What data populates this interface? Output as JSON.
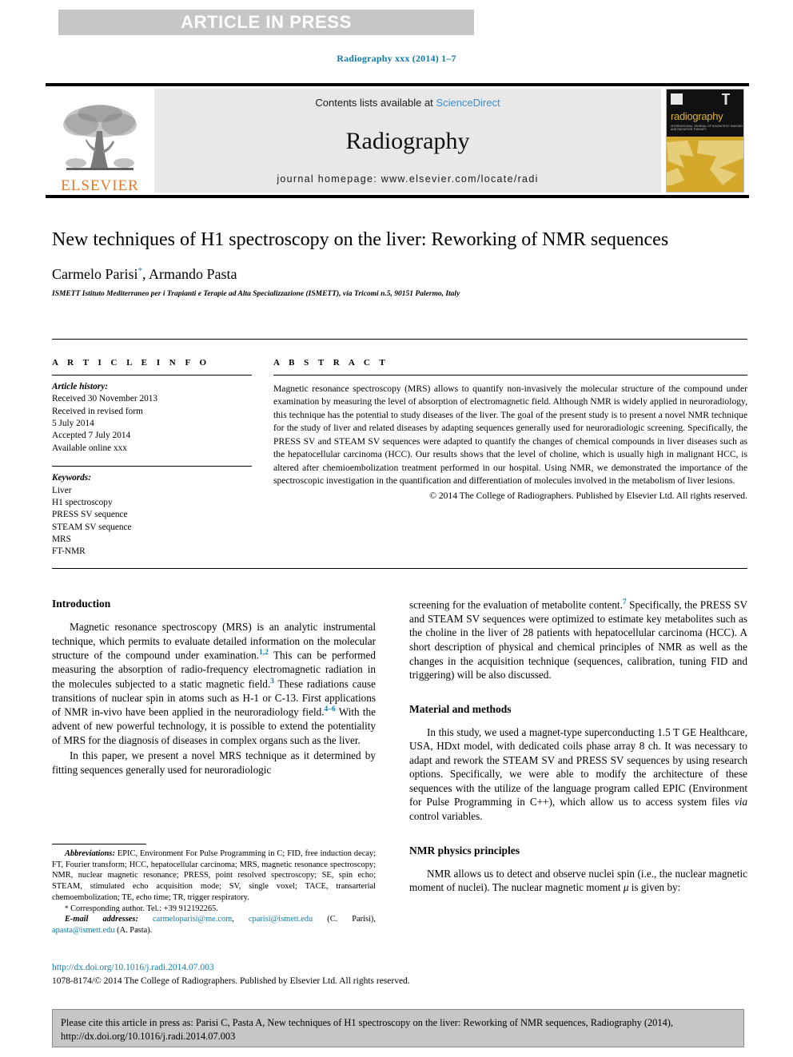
{
  "banner": {
    "text": "ARTICLE IN PRESS"
  },
  "running_head": "Radiography xxx (2014) 1–7",
  "masthead": {
    "publisher_name": "ELSEVIER",
    "contents_prefix": "Contents lists available at ",
    "contents_link": "ScienceDirect",
    "journal_name": "Radiography",
    "homepage": "journal homepage: www.elsevier.com/locate/radi",
    "cover_title": "radiography",
    "cover_subtitle": "INTERNATIONAL JOURNAL OF DIAGNOSTIC IMAGING AND RADIATION THERAPY"
  },
  "article": {
    "title": "New techniques of H1 spectroscopy on the liver: Reworking of NMR sequences",
    "authors": "Carmelo Parisi",
    "author_marker": "*",
    "authors_rest": ", Armando Pasta",
    "affiliation": "ISMETT Istituto Mediterraneo per i Trapianti e Terapie ad Alta Specializzazione (ISMETT), via Tricomi n.5, 90151 Palermo, Italy"
  },
  "info": {
    "label": "A R T I C L E   I N F O",
    "history_label": "Article history:",
    "history": [
      "Received 30 November 2013",
      "Received in revised form",
      "5 July 2014",
      "Accepted 7 July 2014",
      "Available online xxx"
    ],
    "keywords_label": "Keywords:",
    "keywords": [
      "Liver",
      "H1 spectroscopy",
      "PRESS SV sequence",
      "STEAM SV sequence",
      "MRS",
      "FT-NMR"
    ]
  },
  "abstract": {
    "label": "A B S T R A C T",
    "text": "Magnetic resonance spectroscopy (MRS) allows to quantify non-invasively the molecular structure of the compound under examination by measuring the level of absorption of electromagnetic field. Although NMR is widely applied in neuroradiology, this technique has the potential to study diseases of the liver. The goal of the present study is to present a novel NMR technique for the study of liver and related diseases by adapting sequences generally used for neuroradiologic screening. Specifically, the PRESS SV and STEAM SV sequences were adapted to quantify the changes of chemical compounds in liver diseases such as the hepatocellular carcinoma (HCC). Our results shows that the level of choline, which is usually high in malignant HCC, is altered after chemioembolization treatment performed in our hospital. Using NMR, we demonstrated the importance of the spectroscopic investigation in the quantification and differentiation of molecules involved in the metabolism of liver lesions.",
    "copyright": "© 2014 The College of Radiographers. Published by Elsevier Ltd. All rights reserved."
  },
  "body": {
    "intro_heading": "Introduction",
    "intro_p1_a": "Magnetic resonance spectroscopy (MRS) is an analytic instrumental technique, which permits to evaluate detailed information on the molecular structure of the compound under examination.",
    "intro_p1_ref1": "1,2",
    "intro_p1_b": " This can be performed measuring the absorption of radio-frequency electromagnetic radiation in the molecules subjected to a static magnetic field.",
    "intro_p1_ref2": "3",
    "intro_p1_c": " These radiations cause transitions of nuclear spin in atoms such as H-1 or C-13. First applications of NMR in-vivo have been applied in the neuroradiology field.",
    "intro_p1_ref3": "4–6",
    "intro_p1_d": " With the advent of new powerful technology, it is possible to extend the potentiality of MRS for the diagnosis of diseases in complex organs such as the liver.",
    "intro_p2": "In this paper, we present a novel MRS technique as it determined by fitting sequences generally used for neuroradiologic",
    "right_p1_a": "screening for the evaluation of metabolite content.",
    "right_p1_ref": "7",
    "right_p1_b": " Specifically, the PRESS SV and STEAM SV sequences were optimized to estimate key metabolites such as the choline in the liver of 28 patients with hepatocellular carcinoma (HCC). A short description of physical and chemical principles of NMR as well as the changes in the acquisition technique (sequences, calibration, tuning FID and triggering) will be also discussed.",
    "methods_heading": "Material and methods",
    "methods_p1_a": "In this study, we used a magnet-type superconducting 1.5 T GE Healthcare, USA, HDxt model, with dedicated coils phase array 8 ch. It was necessary to adapt and rework the STEAM SV and PRESS SV sequences by using research options. Specifically, we were able to modify the architecture of these sequences with the utilize of the language program called EPIC (Environment for Pulse Programming in C++), which allow us to access system files ",
    "methods_p1_italic": "via",
    "methods_p1_b": " control variables.",
    "nmr_heading": "NMR physics principles",
    "nmr_p1_a": "NMR allows us to detect and observe nuclei spin (i.e., the nuclear magnetic moment of nuclei). The nuclear magnetic moment ",
    "nmr_p1_symbol": "μ",
    "nmr_p1_b": " is given by:"
  },
  "footnotes": {
    "abbrev_label": "Abbreviations:",
    "abbrev_text": " EPIC, Environment For Pulse Programming in C; FID, free induction decay; FT, Fourier transform; HCC, hepatocellular carcinoma; MRS, magnetic resonance spectroscopy; NMR, nuclear magnetic resonance; PRESS, point resolved spectroscopy; SE, spin echo; STEAM, stimulated echo acquisition mode; SV, single voxel; TACE, transarterial chemoembolization; TE, echo time; TR, trigger respiratory.",
    "corresponding_marker": "*",
    "corresponding_text": " Corresponding author. Tel.: +39 912192265.",
    "email_label": "E-mail addresses:",
    "email1": "carmeloparisi@me.com",
    "email2": "cparisi@ismett.edu",
    "email_author1": " (C. Parisi), ",
    "email3": "apasta@ismett.edu",
    "email_author2": " (A. Pasta)."
  },
  "footer": {
    "doi": "http://dx.doi.org/10.1016/j.radi.2014.07.003",
    "imprint": "1078-8174/© 2014 The College of Radiographers. Published by Elsevier Ltd. All rights reserved.",
    "citation": "Please cite this article in press as: Parisi C, Pasta A, New techniques of H1 spectroscopy on the liver: Reworking of NMR sequences, Radiography (2014), http://dx.doi.org/10.1016/j.radi.2014.07.003"
  },
  "colors": {
    "link": "#0f7ba8",
    "banner_bg": "#c6c6c6",
    "elsevier_orange": "#e87722",
    "sciencedirect_blue": "#3b8fd1",
    "cover_gold": "#d4a82a"
  }
}
